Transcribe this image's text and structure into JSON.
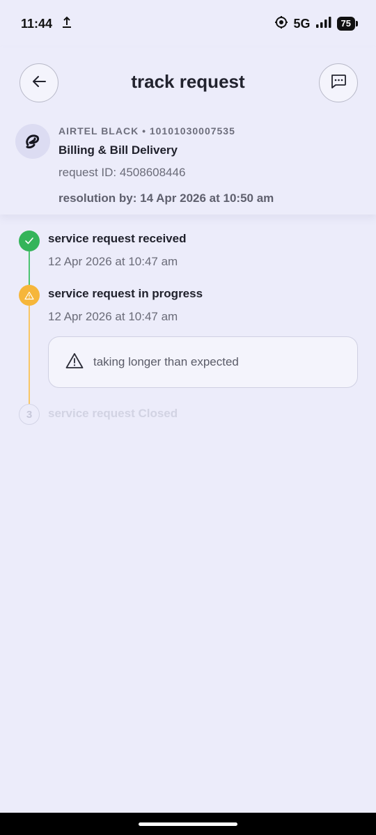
{
  "status_bar": {
    "time": "11:44",
    "network": "5G",
    "battery": "75"
  },
  "header": {
    "title": "track request"
  },
  "request": {
    "account": "AIRTEL BLACK • 10101030007535",
    "category": "Billing & Bill Delivery",
    "request_id": "request ID: 4508608446",
    "resolution": "resolution by: 14 Apr 2026 at 10:50 am"
  },
  "timeline": {
    "steps": [
      {
        "title": "service request received",
        "time": "12 Apr 2026 at 10:47 am",
        "status": "done"
      },
      {
        "title": "service request in progress",
        "time": "12 Apr 2026 at 10:47 am",
        "status": "delayed"
      },
      {
        "title": "service request Closed",
        "number": "3",
        "status": "pending"
      }
    ],
    "warning": "taking longer than expected"
  },
  "colors": {
    "background": "#ececfa",
    "done": "#34b45a",
    "progress": "#f6b63a",
    "pending": "#d2d3e3"
  }
}
